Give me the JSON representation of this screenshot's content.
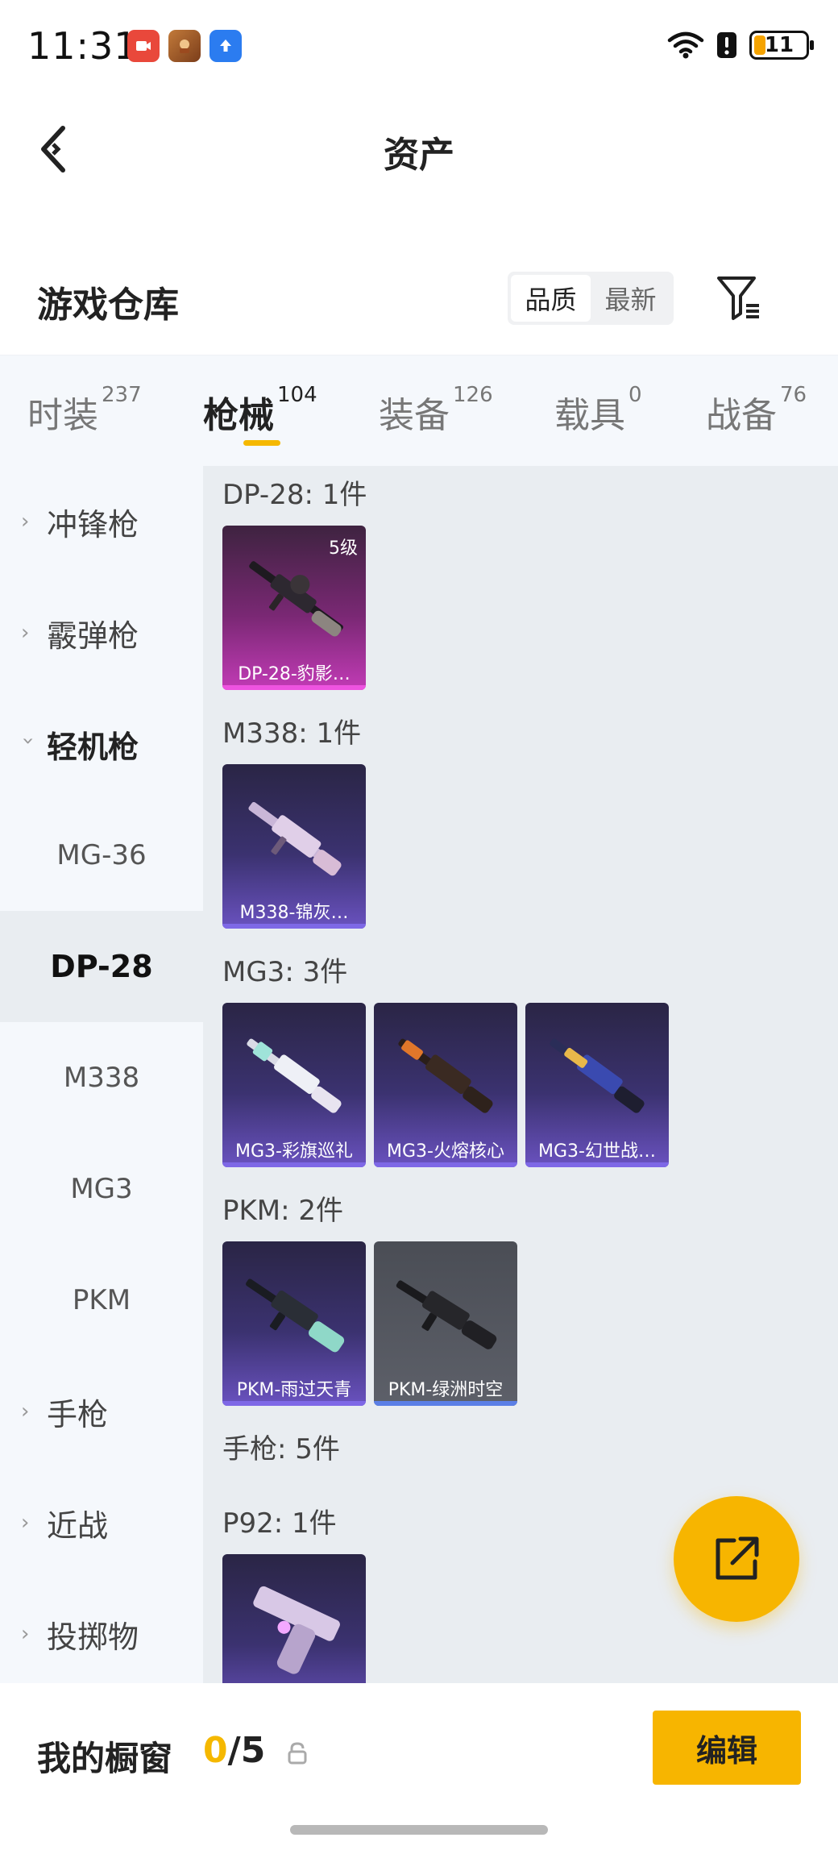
{
  "status": {
    "time": "11:31",
    "battery": "11"
  },
  "header": {
    "title": "资产"
  },
  "warehouse": {
    "title": "游戏仓库",
    "sort_options": [
      "品质",
      "最新"
    ]
  },
  "tabs": [
    {
      "label": "时装",
      "count": "237"
    },
    {
      "label": "枪械",
      "count": "104"
    },
    {
      "label": "装备",
      "count": "126"
    },
    {
      "label": "载具",
      "count": "0"
    },
    {
      "label": "战备",
      "count": "76"
    }
  ],
  "sidebar": {
    "categories": [
      {
        "label": "冲锋枪"
      },
      {
        "label": "霰弹枪"
      },
      {
        "label": "轻机枪"
      },
      {
        "label": "手枪"
      },
      {
        "label": "近战"
      },
      {
        "label": "投掷物"
      }
    ],
    "sub_items": [
      "MG-36",
      "DP-28",
      "M338",
      "MG3",
      "PKM"
    ]
  },
  "sections": [
    {
      "title": "DP-28: 1件",
      "items": [
        {
          "name": "DP-28-豹影…",
          "level": "5级",
          "rarity": "pink"
        }
      ]
    },
    {
      "title": "M338: 1件",
      "items": [
        {
          "name": "M338-锦灰…",
          "rarity": "purple"
        }
      ]
    },
    {
      "title": "MG3: 3件",
      "items": [
        {
          "name": "MG3-彩旗巡礼",
          "rarity": "purple"
        },
        {
          "name": "MG3-火熔核心",
          "rarity": "purple"
        },
        {
          "name": "MG3-幻世战…",
          "rarity": "purple"
        }
      ]
    },
    {
      "title": "PKM: 2件",
      "items": [
        {
          "name": "PKM-雨过天青",
          "rarity": "purple"
        },
        {
          "name": "PKM-绿洲时空",
          "rarity": "gray"
        }
      ]
    },
    {
      "title": "手枪: 5件"
    },
    {
      "title": "P92: 1件",
      "items": [
        {
          "rarity": "purple"
        }
      ]
    }
  ],
  "bottom": {
    "label": "我的橱窗",
    "count_current": "0",
    "count_total": "/5",
    "edit_label": "编辑"
  },
  "colors": {
    "accent": "#f7b500",
    "pink_rarity": "#ee53e0",
    "purple_rarity": "#7e68e6"
  }
}
